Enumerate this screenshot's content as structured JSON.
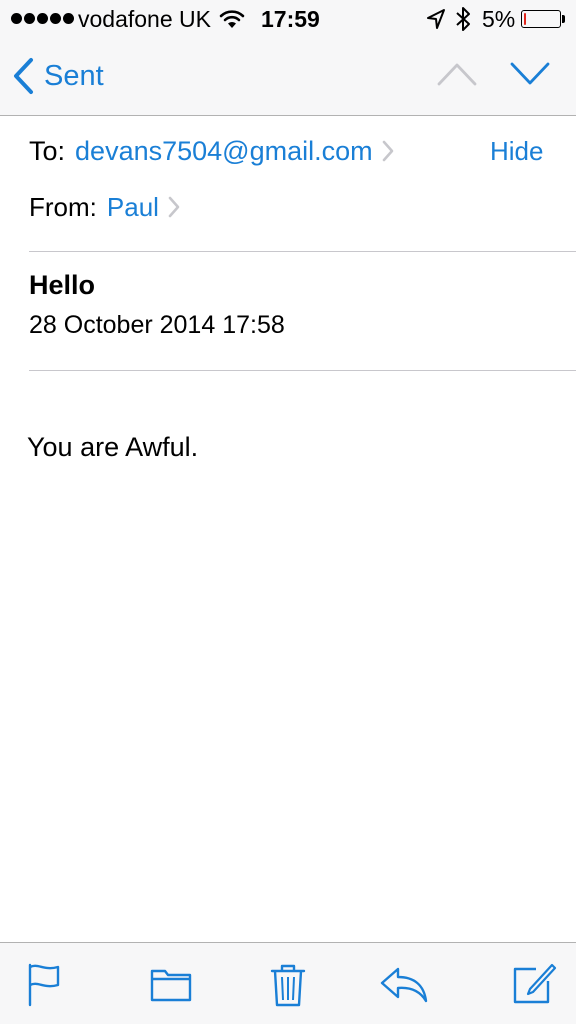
{
  "status_bar": {
    "carrier": "vodafone UK",
    "time": "17:59",
    "battery_percent_label": "5%",
    "battery_level": 0.05,
    "signal_dots": 5,
    "battery_color": "#e0261c"
  },
  "nav": {
    "back_label": "Sent",
    "accent_color": "#1a7fd6"
  },
  "header": {
    "to_label": "To:",
    "to_address": "devans7504@gmail.com",
    "hide_label": "Hide",
    "from_label": "From:",
    "from_name": "Paul"
  },
  "message": {
    "subject": "Hello",
    "date": "28 October 2014 17:58",
    "body": "You are Awful."
  },
  "toolbar": {
    "icons": [
      "flag-icon",
      "folder-icon",
      "trash-icon",
      "reply-icon",
      "compose-icon"
    ]
  }
}
